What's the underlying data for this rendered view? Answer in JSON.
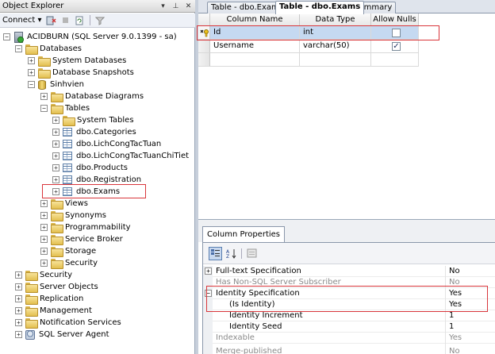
{
  "object_explorer": {
    "title": "Object Explorer",
    "title_buttons": [
      "▾",
      "⊥",
      "✕"
    ],
    "toolbar": {
      "connect_label": "Connect ▾"
    },
    "tree": {
      "server": "ACIDBURN (SQL Server 9.0.1399 - sa)",
      "databases": "Databases",
      "system_databases": "System Databases",
      "database_snapshots": "Database Snapshots",
      "sinhvien": "Sinhvien",
      "database_diagrams": "Database Diagrams",
      "tables": "Tables",
      "system_tables": "System Tables",
      "table_items": [
        "dbo.Categories",
        "dbo.LichCongTacTuan",
        "dbo.LichCongTacTuanChiTiet",
        "dbo.Products",
        "dbo.Registration",
        "dbo.Exams"
      ],
      "views": "Views",
      "synonyms": "Synonyms",
      "programmability": "Programmability",
      "service_broker": "Service Broker",
      "storage": "Storage",
      "db_security": "Security",
      "security": "Security",
      "server_objects": "Server Objects",
      "replication": "Replication",
      "management": "Management",
      "notification_services": "Notification Services",
      "sql_server_agent": "SQL Server Agent"
    }
  },
  "tabs": [
    "Table - dbo.Exams",
    "Table - dbo.Exams",
    "Summary"
  ],
  "grid": {
    "headers": {
      "column_name": "Column Name",
      "data_type": "Data Type",
      "allow_nulls": "Allow Nulls"
    },
    "rows": [
      {
        "name": "Id",
        "type": "int",
        "allow_nulls": ""
      },
      {
        "name": "Username",
        "type": "varchar(50)",
        "allow_nulls": "✓"
      }
    ]
  },
  "column_properties": {
    "tab_label": "Column Properties",
    "rows": [
      {
        "name": "Full-text Specification",
        "value": "No"
      },
      {
        "name": "Has Non-SQL Server Subscriber",
        "value": "No"
      },
      {
        "name": "Identity Specification",
        "value": "Yes"
      },
      {
        "name": "(Is Identity)",
        "value": "Yes"
      },
      {
        "name": "Identity Increment",
        "value": "1"
      },
      {
        "name": "Identity Seed",
        "value": "1"
      },
      {
        "name": "Indexable",
        "value": "Yes"
      },
      {
        "name": "Merge-published",
        "value": "No"
      }
    ]
  },
  "colors": {
    "highlight_border": "#d9363b",
    "selected_row": "#c5d9f1"
  }
}
